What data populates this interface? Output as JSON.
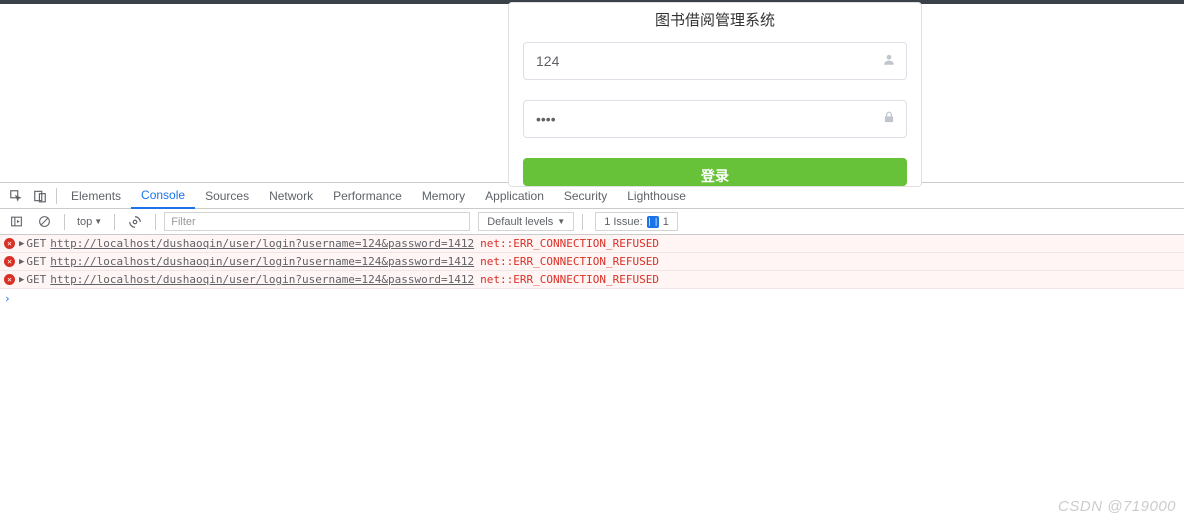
{
  "page": {
    "title": "图书借阅管理系统",
    "username_value": "124",
    "password_display": "••••",
    "login_button": "登录"
  },
  "devtools": {
    "tabs": [
      "Elements",
      "Console",
      "Sources",
      "Network",
      "Performance",
      "Memory",
      "Application",
      "Security",
      "Lighthouse"
    ],
    "active_tab": "Console",
    "context": "top",
    "filter_placeholder": "Filter",
    "levels_label": "Default levels",
    "issues_label": "1 Issue:",
    "issues_count": "1",
    "log_entries": [
      {
        "method": "GET",
        "url": "http://localhost/dushaoqin/user/login?username=124&password=1412",
        "error": "net::ERR_CONNECTION_REFUSED"
      },
      {
        "method": "GET",
        "url": "http://localhost/dushaoqin/user/login?username=124&password=1412",
        "error": "net::ERR_CONNECTION_REFUSED"
      },
      {
        "method": "GET",
        "url": "http://localhost/dushaoqin/user/login?username=124&password=1412",
        "error": "net::ERR_CONNECTION_REFUSED"
      }
    ]
  },
  "watermark": "CSDN @719000"
}
